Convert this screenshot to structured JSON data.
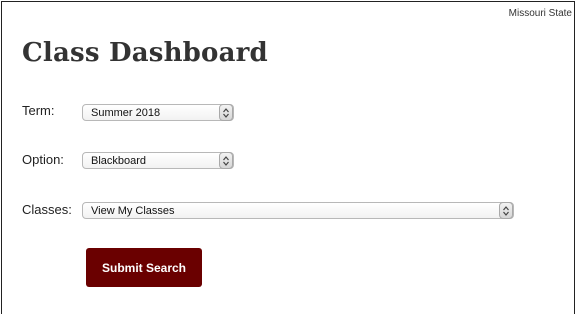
{
  "header": {
    "brand": "Missouri State",
    "title": "Class Dashboard"
  },
  "form": {
    "term": {
      "label": "Term:",
      "selected": "Summer 2018",
      "icon": "up-down-chevron-icon"
    },
    "option": {
      "label": "Option:",
      "selected": "Blackboard",
      "icon": "up-down-chevron-icon"
    },
    "classes": {
      "label": "Classes:",
      "selected": "View My Classes",
      "icon": "up-down-chevron-icon"
    },
    "submit_label": "Submit Search"
  },
  "colors": {
    "submit_bg": "#6a0000",
    "title_text": "#333333"
  }
}
